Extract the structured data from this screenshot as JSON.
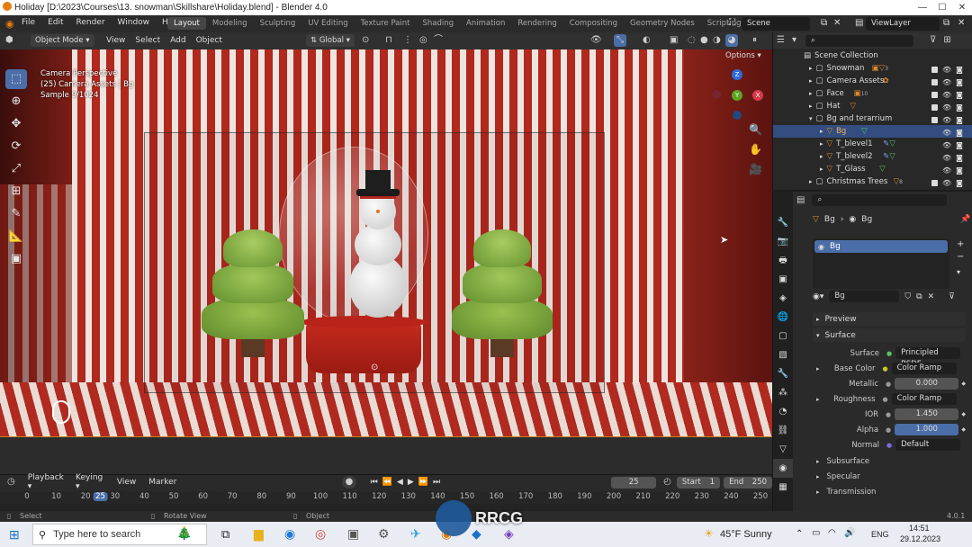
{
  "window": {
    "title": "Holiday [D:\\2023\\Courses\\13. snowman\\Skillshare\\Holiday.blend] - Blender 4.0",
    "minimize": "—",
    "maximize": "☐",
    "close": "✕"
  },
  "menu": [
    "File",
    "Edit",
    "Render",
    "Window",
    "Help"
  ],
  "workspaces": [
    "Layout",
    "Modeling",
    "Sculpting",
    "UV Editing",
    "Texture Paint",
    "Shading",
    "Animation",
    "Rendering",
    "Compositing",
    "Geometry Nodes",
    "Scripting"
  ],
  "workspace_add": "+",
  "scene": {
    "label": "Scene",
    "view_layer": "ViewLayer"
  },
  "viewport_header": {
    "mode": "Object Mode",
    "menus": [
      "View",
      "Select",
      "Add",
      "Object"
    ],
    "orientation": "Global",
    "options": "Options"
  },
  "viewport": {
    "line1": "Camera Perspective",
    "line2": "(25) Camera Assets | Bg",
    "line3": "Sample 9/1024",
    "gizmo": {
      "z": "Z",
      "y": "Y",
      "x": "X"
    }
  },
  "outliner": {
    "title": "Scene Collection",
    "items": [
      {
        "label": "Snowman",
        "badge": "3"
      },
      {
        "label": "Camera Assets",
        "badge": ""
      },
      {
        "label": "Face",
        "badge": "10"
      },
      {
        "label": "Hat",
        "badge": ""
      },
      {
        "label": "Bg and terarrium",
        "badge": ""
      },
      {
        "label": "Bg",
        "badge": ""
      },
      {
        "label": "T_blevel1",
        "badge": ""
      },
      {
        "label": "T_blevel2",
        "badge": ""
      },
      {
        "label": "T_Glass",
        "badge": ""
      },
      {
        "label": "Christmas Trees",
        "badge": "8"
      }
    ]
  },
  "properties": {
    "breadcrumb_object": "Bg",
    "breadcrumb_material": "Bg",
    "slot": "Bg",
    "material_name": "Bg",
    "preview": "Preview",
    "surface_header": "Surface",
    "rows": [
      {
        "label": "Surface",
        "value": "Principled BSDF"
      },
      {
        "label": "Base Color",
        "value": "Color Ramp"
      },
      {
        "label": "Metallic",
        "value": "0.000"
      },
      {
        "label": "Roughness",
        "value": "Color Ramp"
      },
      {
        "label": "IOR",
        "value": "1.450"
      },
      {
        "label": "Alpha",
        "value": "1.000"
      },
      {
        "label": "Normal",
        "value": "Default"
      }
    ],
    "sections": [
      "Subsurface",
      "Specular",
      "Transmission"
    ]
  },
  "timeline": {
    "menus": [
      "Playback",
      "Keying",
      "View",
      "Marker"
    ],
    "current_frame": "25",
    "start_label": "Start",
    "start": "1",
    "end_label": "End",
    "end": "250",
    "ticks": [
      "0",
      "10",
      "20",
      "25",
      "30",
      "40",
      "50",
      "60",
      "70",
      "80",
      "90",
      "100",
      "110",
      "120",
      "130",
      "140",
      "150",
      "160",
      "170",
      "180",
      "190",
      "200",
      "210",
      "220",
      "230",
      "240",
      "250"
    ]
  },
  "statusbar": {
    "select": "Select",
    "rotate": "Rotate View",
    "object": "Object",
    "version": "4.0.1"
  },
  "taskbar": {
    "search": "Type here to search",
    "weather": "45°F  Sunny",
    "lang": "ENG",
    "time": "14:51",
    "date": "29.12.2023"
  },
  "watermark": "RRCG"
}
